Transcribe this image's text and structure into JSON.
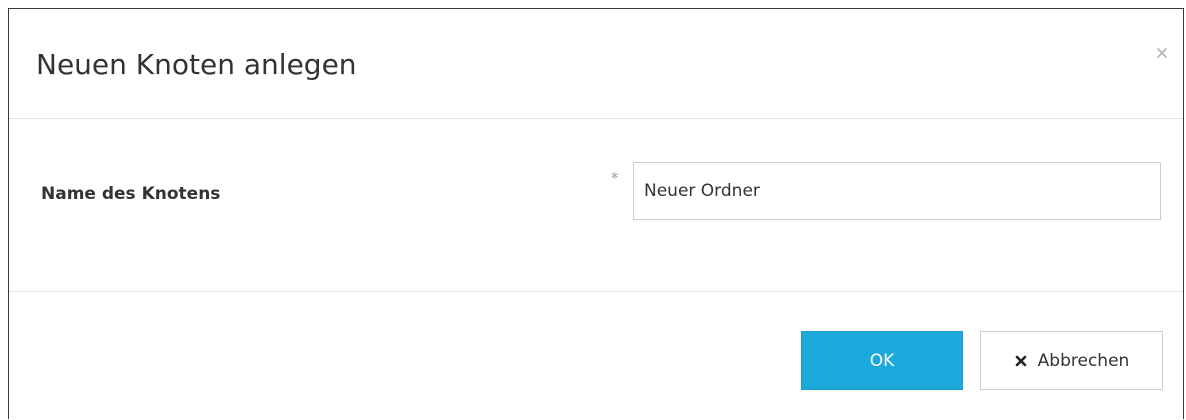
{
  "dialog": {
    "title": "Neuen Knoten anlegen",
    "close_icon": "close-icon"
  },
  "form": {
    "name_label": "Name des Knotens",
    "required_marker": "*",
    "name_value": "Neuer Ordner"
  },
  "footer": {
    "ok_label": "OK",
    "cancel_label": "Abbrechen",
    "cancel_icon": "x-icon"
  },
  "colors": {
    "primary_button": "#1ba8da",
    "text": "#333333",
    "border": "#cccccc"
  }
}
